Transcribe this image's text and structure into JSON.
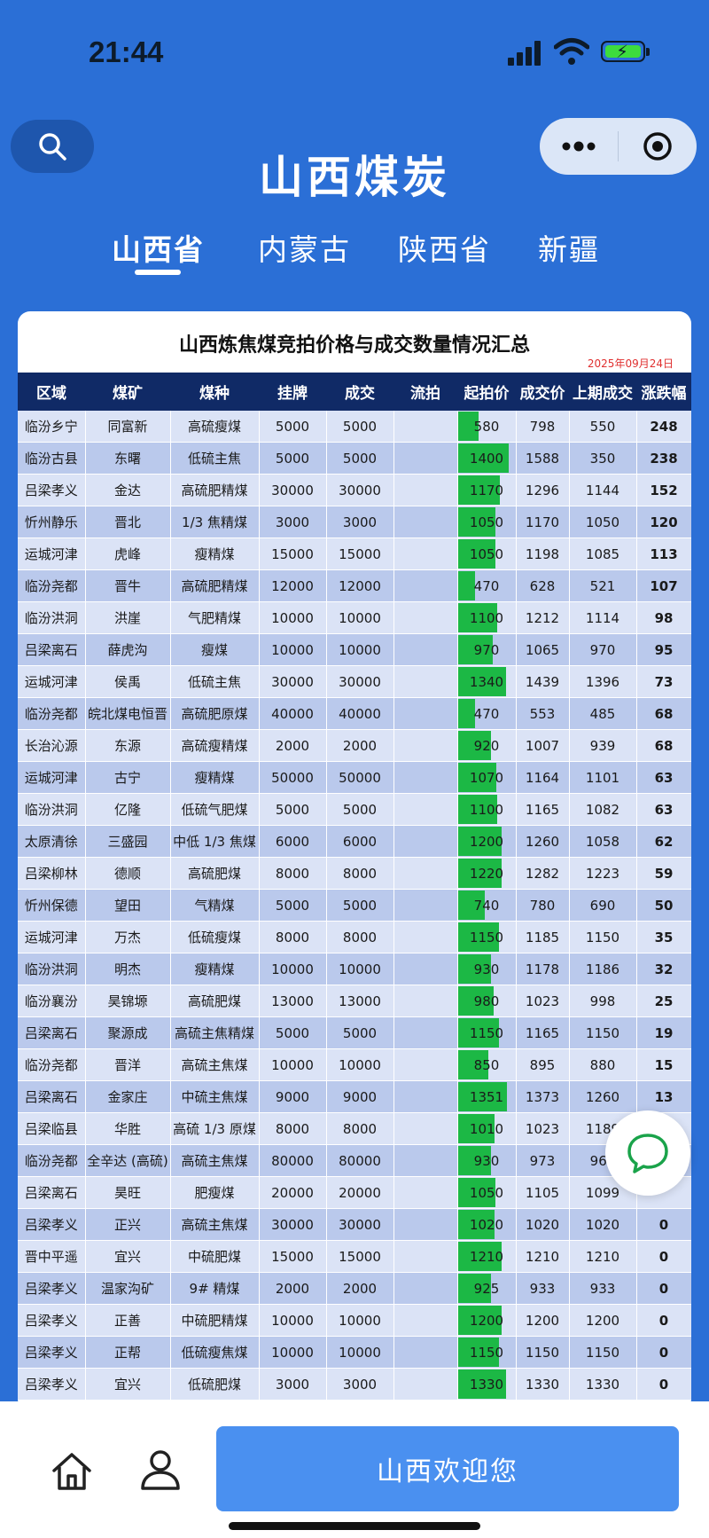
{
  "status": {
    "time": "21:44"
  },
  "header": {
    "title": "山西煤炭"
  },
  "tabs": [
    "山西省",
    "内蒙古",
    "陕西省",
    "新疆"
  ],
  "table": {
    "title": "山西炼焦煤竞拍价格与成交数量情况汇总",
    "date": "2025年09月24日",
    "columns": [
      "区域",
      "煤矿",
      "煤种",
      "挂牌",
      "成交",
      "流拍",
      "起拍价",
      "成交价",
      "上期成交",
      "涨跌幅"
    ],
    "rows": [
      [
        "临汾乡宁",
        "同富新",
        "高硫瘦煤",
        "5000",
        "5000",
        "",
        "580",
        "798",
        "550",
        "248"
      ],
      [
        "临汾古县",
        "东曙",
        "低硫主焦",
        "5000",
        "5000",
        "",
        "1400",
        "1588",
        "350",
        "238"
      ],
      [
        "吕梁孝义",
        "金达",
        "高硫肥精煤",
        "30000",
        "30000",
        "",
        "1170",
        "1296",
        "1144",
        "152"
      ],
      [
        "忻州静乐",
        "晋北",
        "1/3 焦精煤",
        "3000",
        "3000",
        "",
        "1050",
        "1170",
        "1050",
        "120"
      ],
      [
        "运城河津",
        "虎峰",
        "瘦精煤",
        "15000",
        "15000",
        "",
        "1050",
        "1198",
        "1085",
        "113"
      ],
      [
        "临汾尧都",
        "晋牛",
        "高硫肥精煤",
        "12000",
        "12000",
        "",
        "470",
        "628",
        "521",
        "107"
      ],
      [
        "临汾洪洞",
        "洪崖",
        "气肥精煤",
        "10000",
        "10000",
        "",
        "1100",
        "1212",
        "1114",
        "98"
      ],
      [
        "吕梁离石",
        "薛虎沟",
        "瘦煤",
        "10000",
        "10000",
        "",
        "970",
        "1065",
        "970",
        "95"
      ],
      [
        "运城河津",
        "侯禹",
        "低硫主焦",
        "30000",
        "30000",
        "",
        "1340",
        "1439",
        "1396",
        "73"
      ],
      [
        "临汾尧都",
        "皖北煤电恒晋",
        "高硫肥原煤",
        "40000",
        "40000",
        "",
        "470",
        "553",
        "485",
        "68"
      ],
      [
        "长治沁源",
        "东源",
        "高硫瘦精煤",
        "2000",
        "2000",
        "",
        "920",
        "1007",
        "939",
        "68"
      ],
      [
        "运城河津",
        "古宁",
        "瘦精煤",
        "50000",
        "50000",
        "",
        "1070",
        "1164",
        "1101",
        "63"
      ],
      [
        "临汾洪洞",
        "亿隆",
        "低硫气肥煤",
        "5000",
        "5000",
        "",
        "1100",
        "1165",
        "1082",
        "63"
      ],
      [
        "太原清徐",
        "三盛园",
        "中低 1/3 焦煤",
        "6000",
        "6000",
        "",
        "1200",
        "1260",
        "1058",
        "62"
      ],
      [
        "吕梁柳林",
        "德顺",
        "高硫肥煤",
        "8000",
        "8000",
        "",
        "1220",
        "1282",
        "1223",
        "59"
      ],
      [
        "忻州保德",
        "望田",
        "气精煤",
        "5000",
        "5000",
        "",
        "740",
        "780",
        "690",
        "50"
      ],
      [
        "运城河津",
        "万杰",
        "低硫瘦煤",
        "8000",
        "8000",
        "",
        "1150",
        "1185",
        "1150",
        "35"
      ],
      [
        "临汾洪洞",
        "明杰",
        "瘦精煤",
        "10000",
        "10000",
        "",
        "930",
        "1178",
        "1186",
        "32"
      ],
      [
        "临汾襄汾",
        "昊锦塬",
        "高硫肥煤",
        "13000",
        "13000",
        "",
        "980",
        "1023",
        "998",
        "25"
      ],
      [
        "吕梁离石",
        "聚源成",
        "高硫主焦精煤",
        "5000",
        "5000",
        "",
        "1150",
        "1165",
        "1150",
        "19"
      ],
      [
        "临汾尧都",
        "晋洋",
        "高硫主焦煤",
        "10000",
        "10000",
        "",
        "850",
        "895",
        "880",
        "15"
      ],
      [
        "吕梁离石",
        "金家庄",
        "中硫主焦煤",
        "9000",
        "9000",
        "",
        "1351",
        "1373",
        "1260",
        "13"
      ],
      [
        "吕梁临县",
        "华胜",
        "高硫 1/3 原煤",
        "8000",
        "8000",
        "",
        "1010",
        "1023",
        "1189",
        ""
      ],
      [
        "临汾尧都",
        "全辛达 (高硫)",
        "高硫主焦煤",
        "80000",
        "80000",
        "",
        "930",
        "973",
        "965",
        ""
      ],
      [
        "吕梁离石",
        "昊旺",
        "肥瘦煤",
        "20000",
        "20000",
        "",
        "1050",
        "1105",
        "1099",
        ""
      ],
      [
        "吕梁孝义",
        "正兴",
        "高硫主焦煤",
        "30000",
        "30000",
        "",
        "1020",
        "1020",
        "1020",
        "0"
      ],
      [
        "晋中平遥",
        "宜兴",
        "中硫肥煤",
        "15000",
        "15000",
        "",
        "1210",
        "1210",
        "1210",
        "0"
      ],
      [
        "吕梁孝义",
        "温家沟矿",
        "9# 精煤",
        "2000",
        "2000",
        "",
        "925",
        "933",
        "933",
        "0"
      ],
      [
        "吕梁孝义",
        "正善",
        "中硫肥精煤",
        "10000",
        "10000",
        "",
        "1200",
        "1200",
        "1200",
        "0"
      ],
      [
        "吕梁孝义",
        "正帮",
        "低硫瘦焦煤",
        "10000",
        "10000",
        "",
        "1150",
        "1150",
        "1150",
        "0"
      ],
      [
        "吕梁孝义",
        "宜兴",
        "低硫肥煤",
        "3000",
        "3000",
        "",
        "1330",
        "1330",
        "1330",
        "0"
      ]
    ]
  },
  "bottom": {
    "welcome": "山西欢迎您"
  },
  "icons": {
    "search": "search-icon",
    "more": "more-dots-icon",
    "close": "target-close-icon",
    "chat": "chat-bubble-icon",
    "home": "home-icon",
    "profile": "user-icon"
  },
  "colors": {
    "header_bg": "#2b6fd6",
    "table_head": "#102a66",
    "bar": "#1cb845",
    "pct": "#e01b1b",
    "welcome_btn": "#4a90f0"
  }
}
